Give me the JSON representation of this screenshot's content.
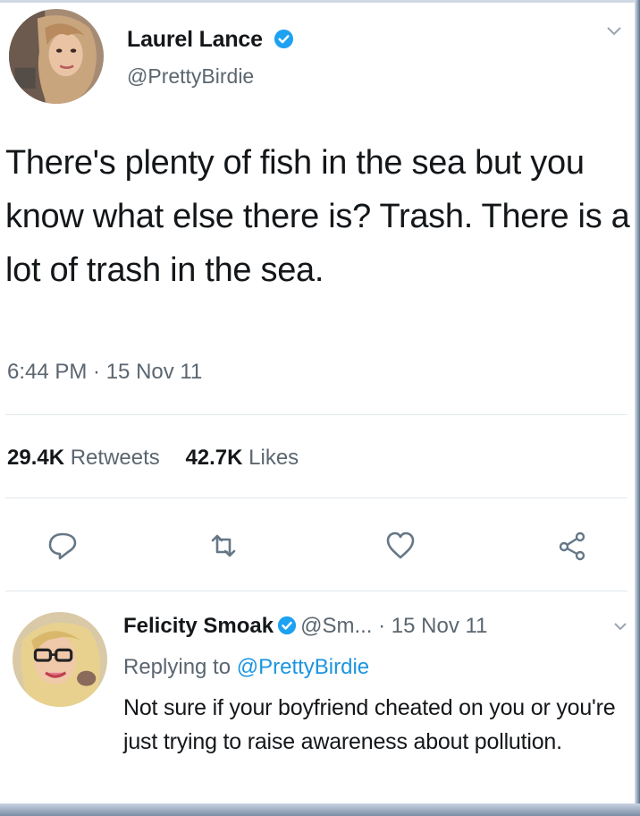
{
  "tweet": {
    "author_name": "Laurel Lance",
    "author_handle": "@PrettyBirdie",
    "text": "There's plenty of fish in the sea but you know what else there is? Trash. There is a lot of trash in the sea.",
    "timestamp": "6:44 PM · 15 Nov 11",
    "stats": {
      "retweets_count": "29.4K",
      "retweets_label": "Retweets",
      "likes_count": "42.7K",
      "likes_label": "Likes"
    },
    "actions": [
      "reply-icon",
      "retweet-icon",
      "like-icon",
      "share-icon"
    ]
  },
  "reply": {
    "author_name": "Felicity Smoak",
    "author_handle": "@Sm...",
    "date": "· 15 Nov 11",
    "replying_prefix": "Replying to",
    "replying_mention": "@PrettyBirdie",
    "text": "Not sure if your boyfriend cheated on you or you're just trying to raise awareness about pollution."
  },
  "colors": {
    "verified_blue": "#1da1f2",
    "mention_blue": "#1b95e0",
    "secondary_text": "#5b6670",
    "divider": "#e1e8ed"
  }
}
